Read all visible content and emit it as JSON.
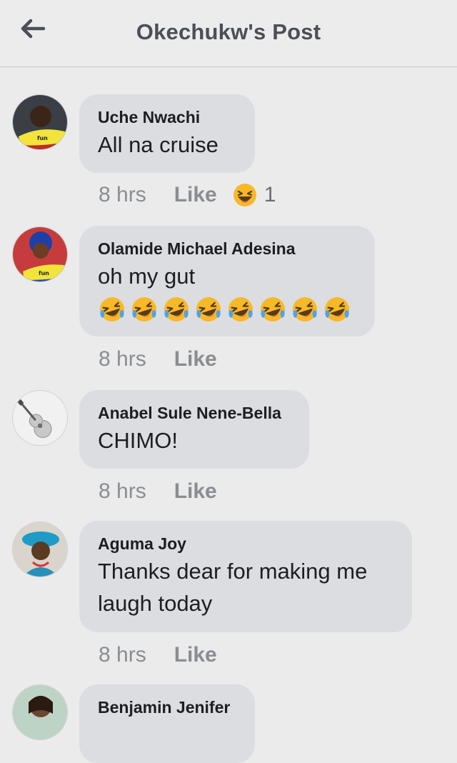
{
  "header": {
    "title": "Okechukw's Post",
    "back_icon": "arrow-left-icon"
  },
  "comments": [
    {
      "name": "Uche Nwachi",
      "text": "All na cruise",
      "time": "8 hrs",
      "like": "Like",
      "reaction_count": "1",
      "reaction_icon": "laughing-face-icon"
    },
    {
      "name": "Olamide Michael Adesina",
      "text": "oh my gut",
      "emoji_count": 8,
      "emoji_icon": "rolling-on-floor-laughing-icon",
      "time": "8 hrs",
      "like": "Like"
    },
    {
      "name": "Anabel Sule Nene-Bella",
      "text": "CHIMO!",
      "time": "8 hrs",
      "like": "Like"
    },
    {
      "name": "Aguma Joy",
      "text_line1": "Thanks dear for making me",
      "text_line2": "laugh today",
      "time": "8 hrs",
      "like": "Like"
    },
    {
      "name": "Benjamin Jenifer"
    }
  ],
  "colors": {
    "background": "#ebebeb",
    "bubble": "#dcdde1",
    "meta_text": "#8a8d91",
    "title_text": "#4b4f56"
  }
}
